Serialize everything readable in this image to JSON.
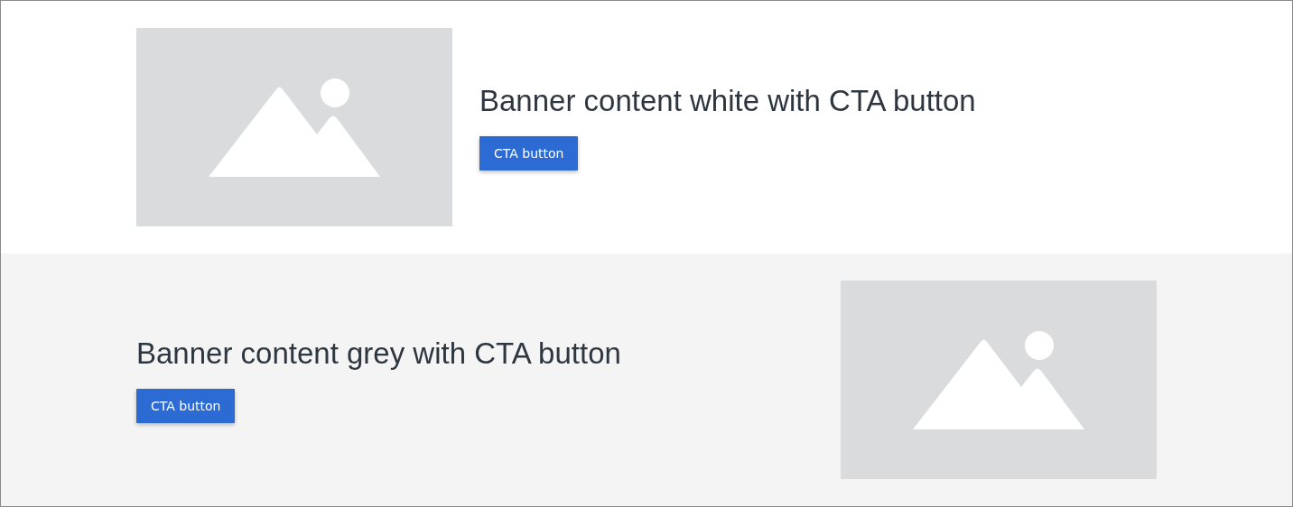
{
  "banners": [
    {
      "kind": "white",
      "heading": "Banner content white with CTA button",
      "button": "CTA button"
    },
    {
      "kind": "grey",
      "heading": "Banner content grey with CTA button",
      "button": "CTA button"
    }
  ]
}
